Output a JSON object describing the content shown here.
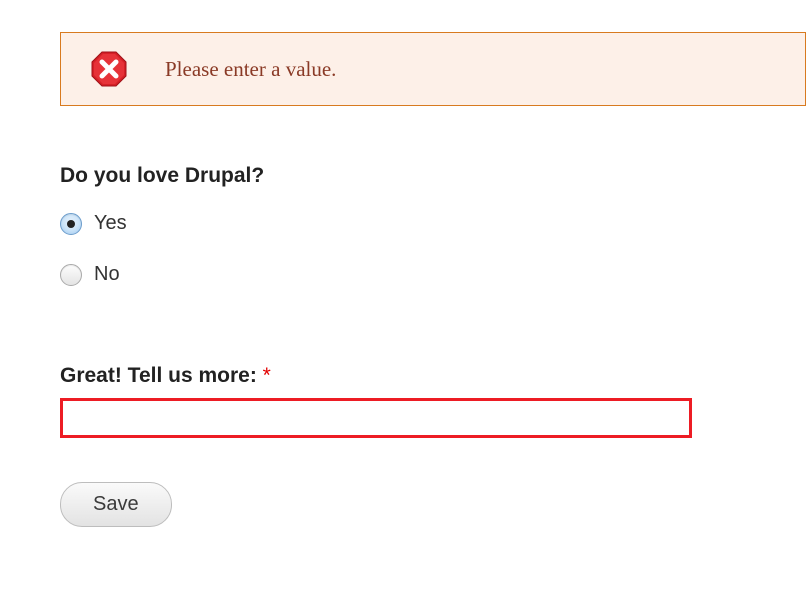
{
  "error": {
    "message": "Please enter a value."
  },
  "question": {
    "label": "Do you love Drupal?",
    "options": [
      {
        "label": "Yes",
        "selected": true
      },
      {
        "label": "No",
        "selected": false
      }
    ]
  },
  "followup": {
    "label": "Great! Tell us more: ",
    "required_mark": "*",
    "value": ""
  },
  "actions": {
    "save_label": "Save"
  }
}
